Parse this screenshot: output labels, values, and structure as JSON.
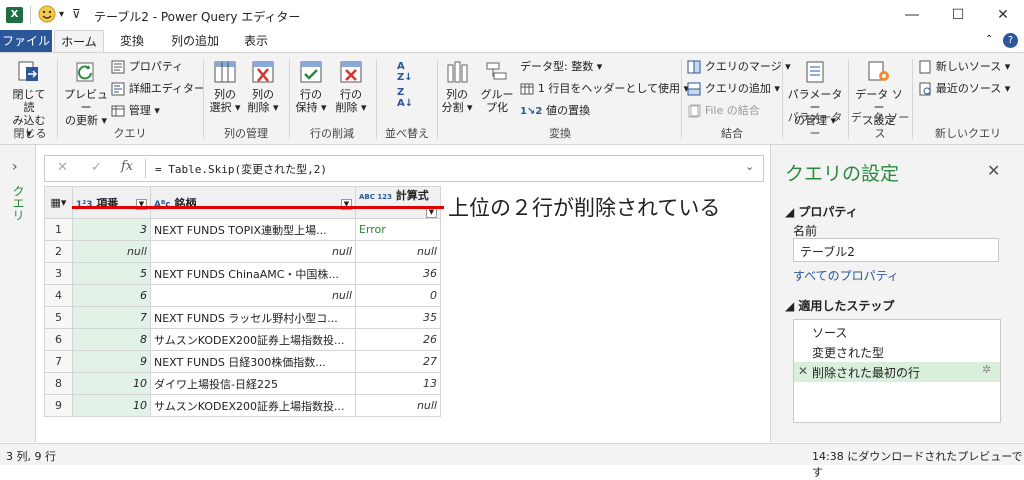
{
  "window": {
    "title": "テーブル2 - Power Query エディター",
    "app_icon": "X"
  },
  "tabs": [
    {
      "label": "ファイル"
    },
    {
      "label": "ホーム"
    },
    {
      "label": "変換"
    },
    {
      "label": "列の追加"
    },
    {
      "label": "表示"
    }
  ],
  "ribbon": {
    "close": {
      "btn1": "閉じて読",
      "btn2": "み込む ▾",
      "group": "閉じる"
    },
    "query": {
      "preview1": "プレビュー",
      "preview2": "の更新 ▾",
      "properties": "プロパティ",
      "advanced": "詳細エディター",
      "manage": "管理 ▾",
      "group": "クエリ"
    },
    "columns": {
      "select1": "列の",
      "select2": "選択 ▾",
      "remove1": "列の",
      "remove2": "削除 ▾",
      "group": "列の管理"
    },
    "rows": {
      "keep1": "行の",
      "keep2": "保持 ▾",
      "remove1": "行の",
      "remove2": "削除 ▾",
      "group": "行の削減"
    },
    "sort": {
      "group": "並べ替え"
    },
    "transform": {
      "split1": "列の",
      "split2": "分割 ▾",
      "groupby1": "グルー",
      "groupby2": "プ化",
      "datatype": "データ型: 整数 ▾",
      "header": "1 行目をヘッダーとして使用 ▾",
      "replace": "値の置換",
      "group": "変換"
    },
    "combine": {
      "merge": "クエリのマージ ▾",
      "append": "クエリの追加 ▾",
      "filecombine": "File の結合",
      "group": "結合"
    },
    "params": {
      "btn1": "パラメーター",
      "btn2": "の管理 ▾",
      "group": "パラメーター"
    },
    "datasource": {
      "btn1": "データ ソー",
      "btn2": "ス設定",
      "group": "データ ソース"
    },
    "newquery": {
      "newsource": "新しいソース ▾",
      "recent": "最近のソース ▾",
      "group": "新しいクエリ"
    }
  },
  "sidebar": {
    "label": "クエリ"
  },
  "formula": {
    "text": "= Table.Skip(変更された型,2)",
    "fx": "fx"
  },
  "grid": {
    "headers": [
      {
        "type": "1²3",
        "name": "項番"
      },
      {
        "type": "Aᴮc",
        "name": "銘柄"
      },
      {
        "type": "ABC 123",
        "name": "計算式"
      }
    ],
    "rows": [
      {
        "n": "1",
        "a": "3",
        "b": "NEXT FUNDS TOPIX連動型上場...",
        "c": "Error"
      },
      {
        "n": "2",
        "a": "null",
        "b": "null",
        "c": "null"
      },
      {
        "n": "3",
        "a": "5",
        "b": "NEXT FUNDS ChinaAMC・中国株...",
        "c": "36"
      },
      {
        "n": "4",
        "a": "6",
        "b": "null",
        "c": "0"
      },
      {
        "n": "5",
        "a": "7",
        "b": "NEXT FUNDS ラッセル野村小型コ...",
        "c": "35"
      },
      {
        "n": "6",
        "a": "8",
        "b": "サムスンKODEX200証券上場指数投...",
        "c": "26"
      },
      {
        "n": "7",
        "a": "9",
        "b": "NEXT FUNDS 日経300株価指数...",
        "c": "27"
      },
      {
        "n": "8",
        "a": "10",
        "b": "ダイワ上場投信-日経225",
        "c": "13"
      },
      {
        "n": "9",
        "a": "10",
        "b": "サムスンKODEX200証券上場指数投...",
        "c": "null"
      }
    ]
  },
  "annotation": {
    "text": "上位の２行が削除されている",
    "color": "#e00000"
  },
  "settings": {
    "title": "クエリの設定",
    "props_heading": "プロパティ",
    "name_label": "名前",
    "name_value": "テーブル2",
    "all_props": "すべてのプロパティ",
    "steps_heading": "適用したステップ",
    "steps": [
      {
        "label": "ソース"
      },
      {
        "label": "変更された型"
      },
      {
        "label": "削除された最初の行"
      }
    ]
  },
  "status": {
    "left": "3 列, 9 行",
    "right": "14:38 にダウンロードされたプレビューです"
  },
  "colors": {
    "accent": "#2b579a",
    "green": "#e3f2e6",
    "red": "#e00000"
  }
}
